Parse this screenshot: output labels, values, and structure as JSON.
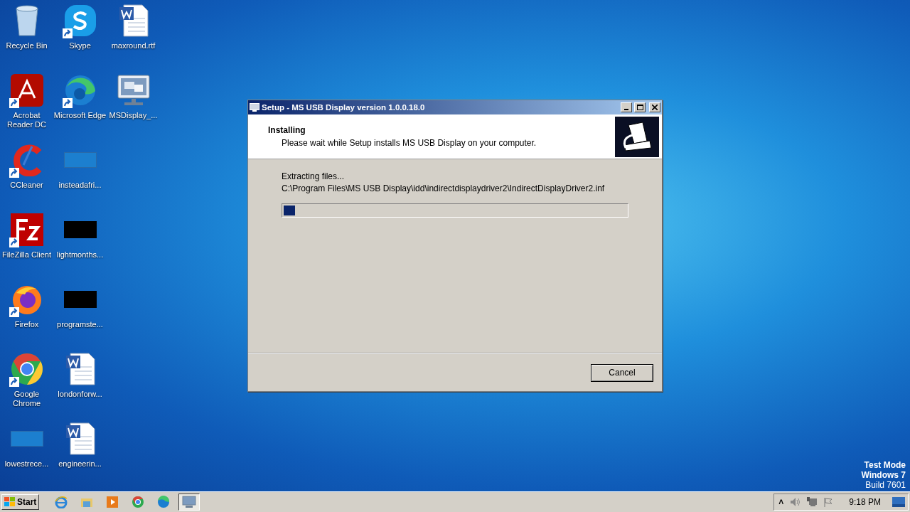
{
  "desktop_icons": [
    {
      "label": "Recycle Bin",
      "kind": "recycle",
      "shortcut": false
    },
    {
      "label": "Acrobat Reader DC",
      "kind": "acrobat",
      "shortcut": true
    },
    {
      "label": "CCleaner",
      "kind": "ccleaner",
      "shortcut": true
    },
    {
      "label": "FileZilla Client",
      "kind": "filezilla",
      "shortcut": true
    },
    {
      "label": "Firefox",
      "kind": "firefox",
      "shortcut": true
    },
    {
      "label": "Google Chrome",
      "kind": "chrome",
      "shortcut": true
    },
    {
      "label": "lowestrece...",
      "kind": "blank",
      "shortcut": false
    },
    {
      "label": "Skype",
      "kind": "skype",
      "shortcut": true
    },
    {
      "label": "Microsoft Edge",
      "kind": "edge",
      "shortcut": true
    },
    {
      "label": "insteadafri...",
      "kind": "blank",
      "shortcut": false
    },
    {
      "label": "lightmonths...",
      "kind": "black",
      "shortcut": false
    },
    {
      "label": "programste...",
      "kind": "black",
      "shortcut": false
    },
    {
      "label": "londonforw...",
      "kind": "word",
      "shortcut": false
    },
    {
      "label": "engineerin...",
      "kind": "word",
      "shortcut": false
    },
    {
      "label": "maxround.rtf",
      "kind": "word",
      "shortcut": false
    },
    {
      "label": "MSDisplay_...",
      "kind": "monitor",
      "shortcut": false
    }
  ],
  "window": {
    "title": "Setup - MS USB Display version 1.0.0.18.0",
    "heading": "Installing",
    "subheading": "Please wait while Setup installs MS USB Display on your computer.",
    "status": "Extracting files...",
    "file": "C:\\Program Files\\MS USB Display\\idd\\indirectdisplaydriver2\\IndirectDisplayDriver2.inf",
    "progress": {
      "level": 0.033
    },
    "buttons": [
      "Cancel"
    ]
  },
  "watermark_lines": [
    "Test Mode",
    "Windows 7",
    "Build 7601"
  ],
  "taskbar": {
    "start": "Start",
    "apps": [
      {
        "kind": "ie",
        "selected": false
      },
      {
        "kind": "explorer",
        "selected": false
      },
      {
        "kind": "media",
        "selected": false
      },
      {
        "kind": "chrome",
        "selected": false
      },
      {
        "kind": "edge",
        "selected": false
      },
      {
        "kind": "monitor",
        "selected": true
      }
    ],
    "tray": {
      "chevron": "˄",
      "time": "9:18 PM"
    }
  }
}
